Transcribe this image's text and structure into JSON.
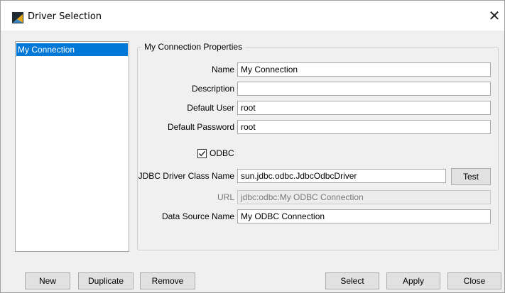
{
  "window": {
    "title": "Driver Selection",
    "close_glyph": "✕"
  },
  "connections": {
    "items": [
      {
        "label": "My Connection",
        "selected": true
      }
    ]
  },
  "properties": {
    "legend": "My Connection Properties",
    "name": {
      "label": "Name",
      "value": "My Connection"
    },
    "description": {
      "label": "Description",
      "value": ""
    },
    "default_user": {
      "label": "Default User",
      "value": "root"
    },
    "default_password": {
      "label": "Default Password",
      "value": "root"
    },
    "odbc": {
      "label": "ODBC",
      "checked": true
    },
    "driver_class": {
      "label": "JDBC Driver Class Name",
      "value": "sun.jdbc.odbc.JdbcOdbcDriver",
      "test_label": "Test"
    },
    "url": {
      "label": "URL",
      "value": "jdbc:odbc:My ODBC Connection",
      "disabled": true
    },
    "data_source": {
      "label": "Data Source Name",
      "value": "My ODBC Connection"
    }
  },
  "buttons": {
    "new": "New",
    "duplicate": "Duplicate",
    "remove": "Remove",
    "select": "Select",
    "apply": "Apply",
    "close": "Close"
  },
  "colors": {
    "selection": "#0078d7",
    "dialog_background": "#f0f0f0",
    "button_background": "#e1e1e1"
  }
}
